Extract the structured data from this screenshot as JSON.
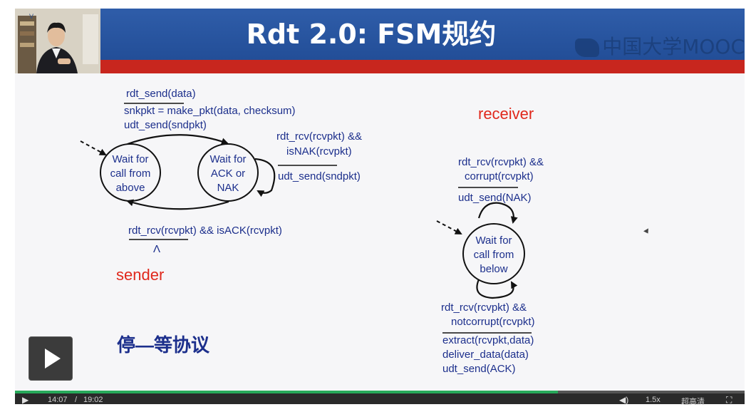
{
  "slide": {
    "title": "Rdt 2.0: FSM规约",
    "logo_text": "中国大学MOOC",
    "chinese_note": "停—等协议",
    "sender": {
      "label": "sender",
      "state_wait_above": [
        "Wait for",
        "call from",
        "above"
      ],
      "state_wait_ack": [
        "Wait for",
        "ACK or",
        "NAK"
      ],
      "top_event": "rdt_send(data)",
      "top_actions": [
        "snkpkt = make_pkt(data, checksum)",
        "udt_send(sndpkt)"
      ],
      "self_event": [
        "rdt_rcv(rcvpkt) &&",
        "isNAK(rcvpkt)"
      ],
      "self_action": "udt_send(sndpkt)",
      "bottom_event": "rdt_rcv(rcvpkt) && isACK(rcvpkt)",
      "bottom_action": "Λ"
    },
    "receiver": {
      "label": "receiver",
      "state_wait_below": [
        "Wait for",
        "call from",
        "below"
      ],
      "top_event": [
        "rdt_rcv(rcvpkt) &&",
        "corrupt(rcvpkt)"
      ],
      "top_action": "udt_send(NAK)",
      "bottom_event": [
        "rdt_rcv(rcvpkt) &&",
        "notcorrupt(rcvpkt)"
      ],
      "bottom_actions": [
        "extract(rcvpkt,data)",
        "deliver_data(data)",
        "udt_send(ACK)"
      ]
    },
    "colors": {
      "ink": "#1c2f8c",
      "accent": "#e0281c",
      "header_blue": "#2557a8",
      "header_red": "#c8261e"
    }
  },
  "player": {
    "current_time": "14:07",
    "separator": "/",
    "duration": "19:02",
    "progress": 0.744,
    "speed": "1.5x",
    "quality": "超高清",
    "icons": [
      "play-icon",
      "volume-icon",
      "fullscreen-icon"
    ]
  }
}
